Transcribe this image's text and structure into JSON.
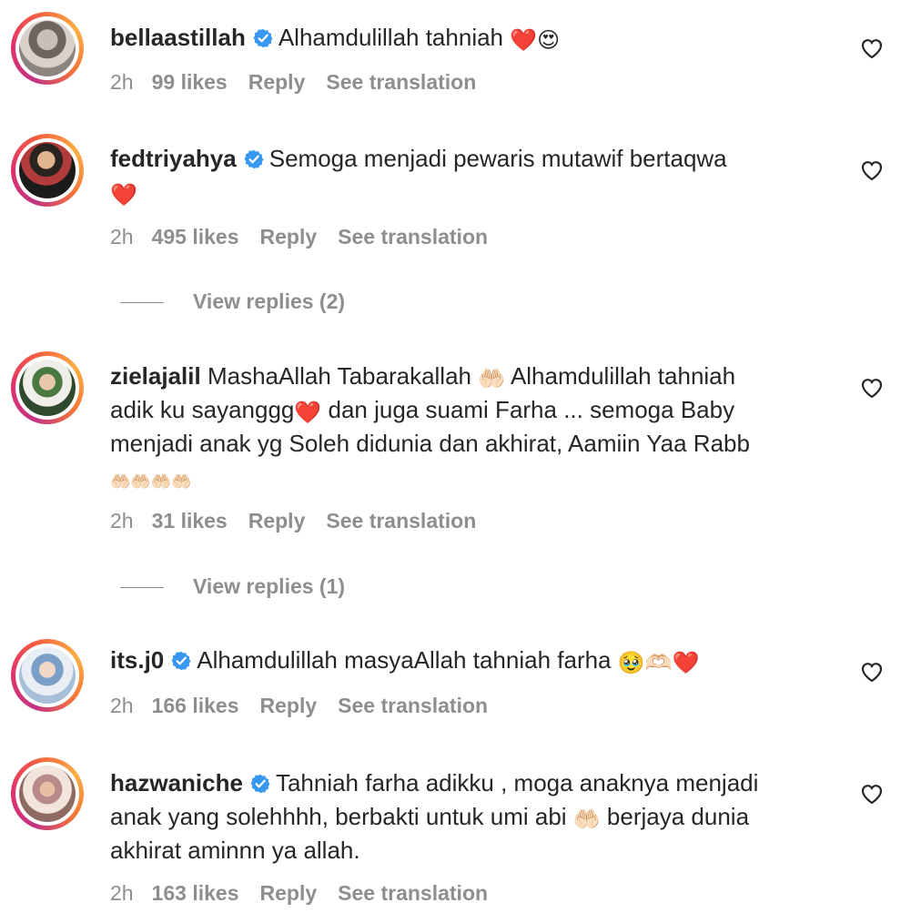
{
  "icons": {
    "verified": "verified-badge-icon",
    "like": "heart-outline-icon"
  },
  "colors": {
    "verified": "#3897f0",
    "muted": "#8e8e8e",
    "heart": "#e0245e"
  },
  "comments": [
    {
      "username": "bellaastillah",
      "verified": true,
      "text": "Alhamdulillah tahniah",
      "emoji": "❤️😍",
      "time": "2h",
      "likes": "99 likes",
      "reply": "Reply",
      "translate": "See translation"
    },
    {
      "username": "fedtriyahya",
      "verified": true,
      "text": "Semoga menjadi pewaris mutawif bertaqwa",
      "emoji": "❤️",
      "time": "2h",
      "likes": "495 likes",
      "reply": "Reply",
      "translate": "See translation",
      "view_replies": "View replies (2)"
    },
    {
      "username": "zielajalil",
      "verified": false,
      "text1": "MashaAllah Tabarakallah",
      "emoji1": "🤲🏻",
      "text2": "Alhamdulillah tahniah",
      "text3": "adik ku sayanggg",
      "emoji2": "❤️",
      "text4": "dan juga suami Farha ... semoga Baby",
      "text5": "menjadi anak yg Soleh didunia dan akhirat, Aamiin Yaa Rabb",
      "emoji3": "🤲🏻🤲🏻🤲🏻🤲🏻",
      "time": "2h",
      "likes": "31 likes",
      "reply": "Reply",
      "translate": "See translation",
      "view_replies": "View replies (1)"
    },
    {
      "username": "its.j0",
      "verified": true,
      "text": "Alhamdulillah masyaAllah tahniah farha",
      "emoji": "🥹🫶🏻❤️",
      "time": "2h",
      "likes": "166 likes",
      "reply": "Reply",
      "translate": "See translation"
    },
    {
      "username": "hazwaniche",
      "verified": true,
      "text1": "Tahniah farha adikku , moga anaknya menjadi",
      "text2": "anak yang solehhhh, berbakti untuk umi abi",
      "emoji": "🤲🏻",
      "text3": "berjaya dunia",
      "text4": "akhirat aminnn ya allah.",
      "time": "2h",
      "likes": "163 likes",
      "reply": "Reply",
      "translate": "See translation"
    }
  ]
}
